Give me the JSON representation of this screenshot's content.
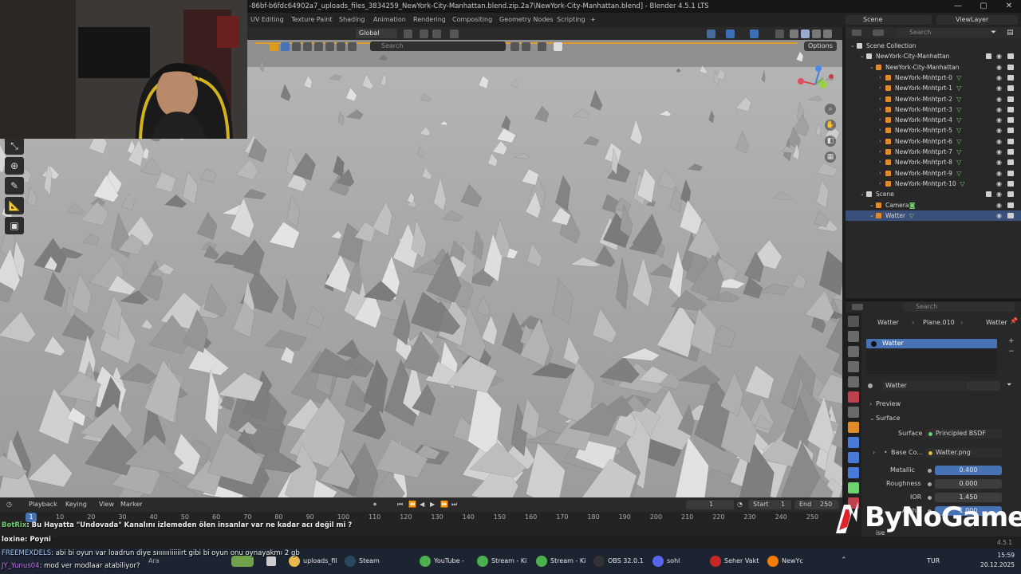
{
  "window": {
    "title": "-86bf-b6fdc64902a7_uploads_files_3834259_NewYork-City-Manhattan.blend.zip.2a7\\NewYork-City-Manhattan.blend] - Blender 4.5.1 LTS",
    "minimize": "—",
    "maximize": "▢",
    "close": "✕"
  },
  "workspace_tabs": [
    "UV Editing",
    "Texture Paint",
    "Shading",
    "Animation",
    "Rendering",
    "Compositing",
    "Geometry Nodes",
    "Scripting",
    "+"
  ],
  "scene_header": {
    "scene": "Scene",
    "view_layer": "ViewLayer"
  },
  "viewport": {
    "transform_orientation": "Global",
    "search_placeholder": "Search",
    "options": "Options"
  },
  "outliner": {
    "search_placeholder": "Search",
    "rows": [
      {
        "label": "Scene Collection",
        "indent": 0,
        "kind": "collection"
      },
      {
        "label": "NewYork-City-Manhattan",
        "indent": 1,
        "kind": "collection"
      },
      {
        "label": "NewYork-City-Manhattan",
        "indent": 2,
        "kind": "object"
      },
      {
        "label": "NewYork-Mnhtprt-0",
        "indent": 3,
        "kind": "mesh"
      },
      {
        "label": "NewYork-Mnhtprt-1",
        "indent": 3,
        "kind": "mesh"
      },
      {
        "label": "NewYork-Mnhtprt-2",
        "indent": 3,
        "kind": "mesh"
      },
      {
        "label": "NewYork-Mnhtprt-3",
        "indent": 3,
        "kind": "mesh"
      },
      {
        "label": "NewYork-Mnhtprt-4",
        "indent": 3,
        "kind": "mesh"
      },
      {
        "label": "NewYork-Mnhtprt-5",
        "indent": 3,
        "kind": "mesh"
      },
      {
        "label": "NewYork-Mnhtprt-6",
        "indent": 3,
        "kind": "mesh"
      },
      {
        "label": "NewYork-Mnhtprt-7",
        "indent": 3,
        "kind": "mesh"
      },
      {
        "label": "NewYork-Mnhtprt-8",
        "indent": 3,
        "kind": "mesh"
      },
      {
        "label": "NewYork-Mnhtprt-9",
        "indent": 3,
        "kind": "mesh"
      },
      {
        "label": "NewYork-Mnhtprt-10",
        "indent": 3,
        "kind": "mesh"
      },
      {
        "label": "Scene",
        "indent": 1,
        "kind": "collection"
      },
      {
        "label": "Camera",
        "indent": 2,
        "kind": "camera"
      },
      {
        "label": "Watter",
        "indent": 2,
        "kind": "mesh",
        "selected": true
      }
    ]
  },
  "properties": {
    "search_placeholder": "Search",
    "breadcrumb": {
      "object": "Watter",
      "data": "Plane.010",
      "material": "Watter"
    },
    "slot": "Watter",
    "material_name": "Watter",
    "panels": {
      "preview": "Preview",
      "surface": "Surface"
    },
    "surface_label": "Surface",
    "surface_value": "Principled BSDF",
    "base_color_label": "Base Co...",
    "base_color_value": "Watter.png",
    "fields": [
      {
        "label": "Metallic",
        "value": "0.400",
        "highlight": true
      },
      {
        "label": "Roughness",
        "value": "0.000",
        "highlight": false
      },
      {
        "label": "IOR",
        "value": "1.450",
        "highlight": false
      },
      {
        "label": "Alpha",
        "value": "1.000",
        "highlight": true
      }
    ],
    "partial_label": "ise"
  },
  "timeline": {
    "menus": [
      "Playback",
      "Keying",
      "View",
      "Marker"
    ],
    "current_frame": "1",
    "start_label": "Start",
    "start_value": "1",
    "end_label": "End",
    "end_value": "250",
    "ruler_cursor": "1",
    "ruler": [
      "10",
      "20",
      "30",
      "40",
      "50",
      "60",
      "70",
      "80",
      "90",
      "100",
      "110",
      "120",
      "130",
      "140",
      "150",
      "160",
      "170",
      "180",
      "190",
      "200",
      "210",
      "220",
      "230",
      "240",
      "250"
    ],
    "version": "4.5.1"
  },
  "chat": [
    {
      "user": "BotRix",
      "text": ": Bu Hayatta \"Undovada\" Kanalını izlemeden ölen insanlar var ne kadar acı değil mi ?",
      "color": "#6fd16f"
    },
    {
      "user": "loxine",
      "text": ": Poyni",
      "color": "#ffffff"
    },
    {
      "user": "FREEMEXDELS",
      "text": ": abi bi oyun var loadrun diye sıııııııiiiiiirt gibi bi oyun onu oynayakmı 2 gb",
      "color": "#9fc6ff"
    },
    {
      "user": "JY_Yunus04",
      "text": ": mod ver modlaar atabiliyor?",
      "color": "#d36cff"
    }
  ],
  "taskbar": {
    "search": "Ara",
    "apps": [
      {
        "label": "uploads_fil",
        "color": "#e8b84a"
      },
      {
        "label": "Steam",
        "color": "#2a475e"
      },
      {
        "label": "YouTube -",
        "color": "#4caf50"
      },
      {
        "label": "Stream - Ki",
        "color": "#4caf50"
      },
      {
        "label": "Stream - Ki",
        "color": "#4caf50"
      },
      {
        "label": "OBS 32.0.1",
        "color": "#333333"
      },
      {
        "label": "sohl",
        "color": "#5865f2"
      },
      {
        "label": "Seher Vakt",
        "color": "#c62828"
      },
      {
        "label": "NewYc",
        "color": "#f57c00"
      }
    ],
    "language": "TUR",
    "time": "15:59",
    "date": "20.12.2025"
  },
  "watermark": "ByNoGame",
  "colors": {
    "accent": "#4772b3",
    "selected_row": "#3a4f7a",
    "mesh_green": "#6fd16f"
  }
}
